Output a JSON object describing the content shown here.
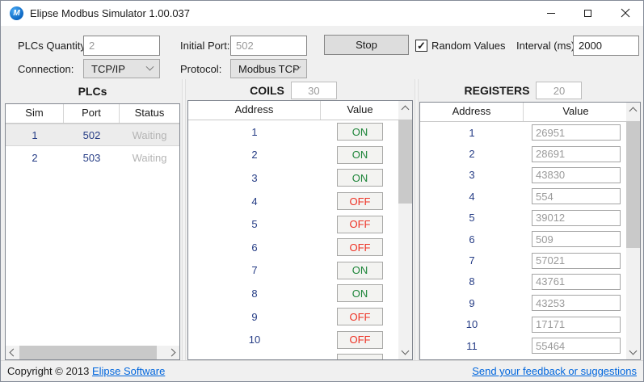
{
  "window": {
    "title": "Elipse Modbus Simulator 1.00.037",
    "app_icon_letter": "M"
  },
  "controls": {
    "plcs_quantity_label": "PLCs Quantity:",
    "plcs_quantity_value": "2",
    "initial_port_label": "Initial Port:",
    "initial_port_value": "502",
    "stop_button_label": "Stop",
    "random_values_label": "Random Values",
    "random_values_checked": true,
    "checkmark_glyph": "✓",
    "interval_label": "Interval (ms):",
    "interval_value": "2000",
    "connection_label": "Connection:",
    "connection_value": "TCP/IP",
    "protocol_label": "Protocol:",
    "protocol_value": "Modbus TCP"
  },
  "plcs": {
    "title": "PLCs",
    "columns": {
      "sim": "Sim",
      "port": "Port",
      "status": "Status"
    },
    "rows": [
      {
        "sim": "1",
        "port": "502",
        "status": "Waiting",
        "selected": true
      },
      {
        "sim": "2",
        "port": "503",
        "status": "Waiting",
        "selected": false
      }
    ]
  },
  "coils": {
    "title": "COILS",
    "count_value": "30",
    "columns": {
      "address": "Address",
      "value": "Value"
    },
    "rows": [
      {
        "address": "1",
        "value": "ON"
      },
      {
        "address": "2",
        "value": "ON"
      },
      {
        "address": "3",
        "value": "ON"
      },
      {
        "address": "4",
        "value": "OFF"
      },
      {
        "address": "5",
        "value": "OFF"
      },
      {
        "address": "6",
        "value": "OFF"
      },
      {
        "address": "7",
        "value": "ON"
      },
      {
        "address": "8",
        "value": "ON"
      },
      {
        "address": "9",
        "value": "OFF"
      },
      {
        "address": "10",
        "value": "OFF"
      }
    ]
  },
  "registers": {
    "title": "REGISTERS",
    "count_value": "20",
    "columns": {
      "address": "Address",
      "value": "Value"
    },
    "rows": [
      {
        "address": "1",
        "value": "26951"
      },
      {
        "address": "2",
        "value": "28691"
      },
      {
        "address": "3",
        "value": "43830"
      },
      {
        "address": "4",
        "value": "554"
      },
      {
        "address": "5",
        "value": "39012"
      },
      {
        "address": "6",
        "value": "509"
      },
      {
        "address": "7",
        "value": "57021"
      },
      {
        "address": "8",
        "value": "43761"
      },
      {
        "address": "9",
        "value": "43253"
      },
      {
        "address": "10",
        "value": "17171"
      },
      {
        "address": "11",
        "value": "55464"
      }
    ]
  },
  "statusbar": {
    "copyright_text": "Copyright © 2013 ",
    "copyright_link": "Elipse Software",
    "feedback_link": "Send your feedback or suggestions"
  },
  "colors": {
    "on": "#1d8539",
    "off": "#ee3124",
    "address_number": "#253c85",
    "waiting": "#b4b4b4",
    "link": "#0066dd"
  }
}
